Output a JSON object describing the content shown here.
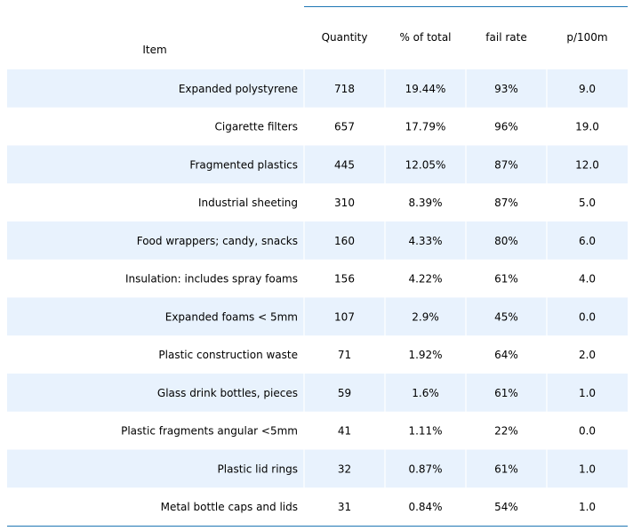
{
  "chart_data": {
    "type": "table",
    "columns": [
      "Item",
      "Quantity",
      "% of total",
      "fail rate",
      "p/100m"
    ],
    "rows": [
      [
        "Expanded polystyrene",
        "718",
        "19.44%",
        "93%",
        "9.0"
      ],
      [
        "Cigarette filters",
        "657",
        "17.79%",
        "96%",
        "19.0"
      ],
      [
        "Fragmented plastics",
        "445",
        "12.05%",
        "87%",
        "12.0"
      ],
      [
        "Industrial sheeting",
        "310",
        "8.39%",
        "87%",
        "5.0"
      ],
      [
        "Food wrappers; candy, snacks",
        "160",
        "4.33%",
        "80%",
        "6.0"
      ],
      [
        "Insulation: includes spray foams",
        "156",
        "4.22%",
        "61%",
        "4.0"
      ],
      [
        "Expanded foams < 5mm",
        "107",
        "2.9%",
        "45%",
        "0.0"
      ],
      [
        "Plastic construction waste",
        "71",
        "1.92%",
        "64%",
        "2.0"
      ],
      [
        "Glass drink bottles, pieces",
        "59",
        "1.6%",
        "61%",
        "1.0"
      ],
      [
        "Plastic fragments angular <5mm",
        "41",
        "1.11%",
        "22%",
        "0.0"
      ],
      [
        "Plastic lid rings",
        "32",
        "0.87%",
        "61%",
        "1.0"
      ],
      [
        "Metal bottle caps and lids",
        "31",
        "0.84%",
        "54%",
        "1.0"
      ]
    ],
    "colors": {
      "band": "#e8f2fd",
      "rule": "#1f77b4",
      "divider": "#ffffff"
    }
  }
}
